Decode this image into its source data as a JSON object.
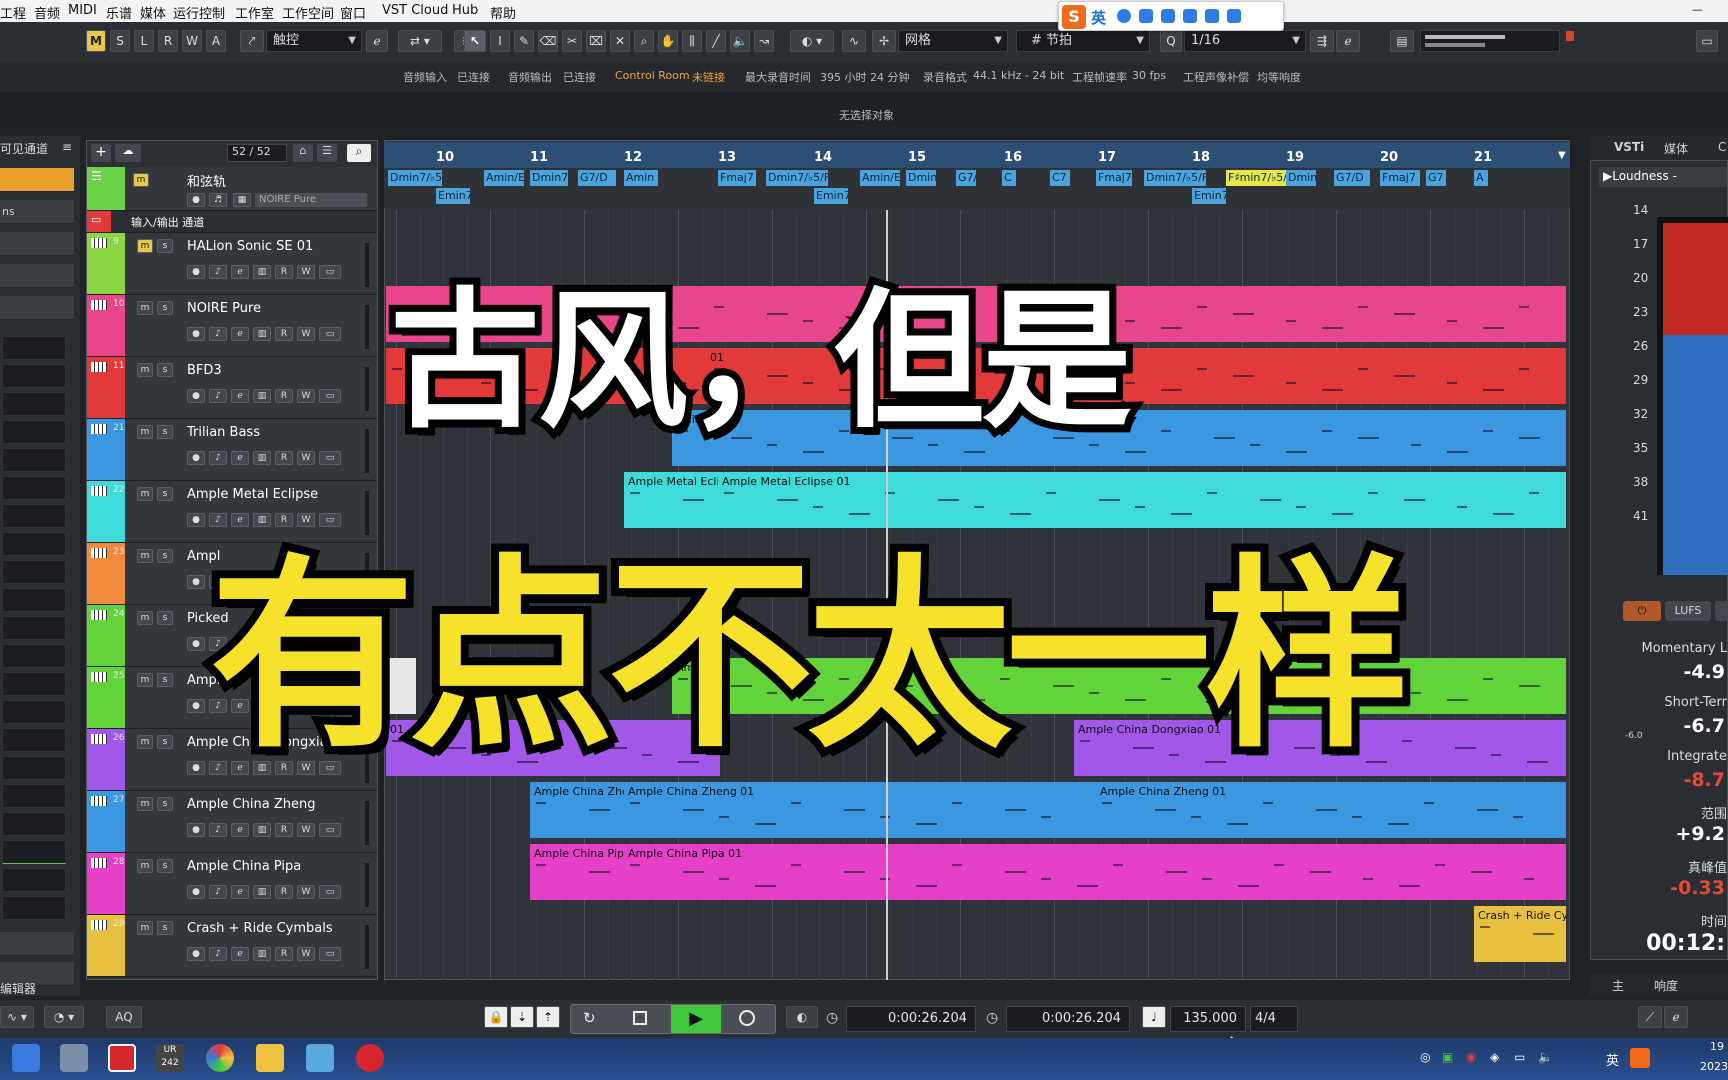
{
  "menu": [
    "工程",
    "音频",
    "MIDI",
    "乐谱",
    "媒体",
    "运行控制",
    "工作室",
    "工作空间",
    "窗口",
    "VST Cloud",
    "Hub",
    "帮助"
  ],
  "ime": {
    "lang": "英"
  },
  "toolbar": {
    "modes": [
      "M",
      "S",
      "L",
      "R",
      "W",
      "A"
    ],
    "automation_mode": "触控",
    "snap_type": "网格",
    "grid_type": "节拍",
    "quantize": "1/16"
  },
  "status": {
    "audio_in_label": "音频输入",
    "audio_in_val": "已连接",
    "audio_out_label": "音频输出",
    "audio_out_val": "已连接",
    "control_room_label": "Control Room",
    "control_room_val": "未链接",
    "max_rec_label": "最大录音时间",
    "max_rec_val": "395 小时 24 分钟",
    "rec_format_label": "录音格式",
    "rec_format_val": "44.1 kHz - 24 bit",
    "frame_rate_label": "工程帧速率",
    "frame_rate_val": "30 fps",
    "pan_law_label": "工程声像补偿",
    "pan_law_val": "均等响度"
  },
  "info_line": "无选择对象",
  "left_panel": {
    "title": "可见通道",
    "row_label": "ns",
    "footer": "编辑器"
  },
  "track_header": {
    "count": "52 / 52"
  },
  "ruler": [
    "10",
    "11",
    "12",
    "13",
    "14",
    "15",
    "16",
    "17",
    "18",
    "19",
    "20",
    "21"
  ],
  "chords": {
    "top": [
      "Dmin7/♭5/F",
      "Amin/E",
      "Dmin7",
      "G7/D",
      "Amin",
      "Fmaj7",
      "Dmin7/♭5/F",
      "Amin/E",
      "Dmin",
      "G7/D",
      "C",
      "C7",
      "Fmaj7",
      "Dmin7/♭5/F",
      "F♯min7/♭5/E",
      "Dmin",
      "G7/D",
      "Fmaj7",
      "G7",
      "A"
    ],
    "bottom": [
      "Emin7",
      "Emin7",
      "Emin7"
    ]
  },
  "chord_track": {
    "name": "和弦轨",
    "instrument": "NOIRE Pure"
  },
  "folder": {
    "name": "输入/输出 通道"
  },
  "tracks": [
    {
      "num": "9",
      "name": "HALion Sonic SE 01",
      "color": "#8bd645"
    },
    {
      "num": "10",
      "name": "NOIRE Pure",
      "color": "#e8468a"
    },
    {
      "num": "11",
      "name": "BFD3",
      "color": "#e23a3a"
    },
    {
      "num": "21",
      "name": "Trilian Bass",
      "color": "#3b97df"
    },
    {
      "num": "22",
      "name": "Ample Metal Eclipse",
      "color": "#3fdada"
    },
    {
      "num": "23",
      "name": "Ampl",
      "color": "#f08a3c"
    },
    {
      "num": "24",
      "name": "Picked",
      "color": "#62d43a"
    },
    {
      "num": "25",
      "name": "Ample C",
      "color": "#62d43a"
    },
    {
      "num": "26",
      "name": "Ample China Dongxiao",
      "color": "#a157e8"
    },
    {
      "num": "27",
      "name": "Ample China Zheng",
      "color": "#3b97df"
    },
    {
      "num": "28",
      "name": "Ample China Pipa",
      "color": "#e63fc8"
    },
    {
      "num": "29",
      "name": "Crash + Ride Cymbals",
      "color": "#e8c040"
    }
  ],
  "parts": {
    "bfd": "01",
    "trilian": "Trilian",
    "metal_a": "Ample Metal Eclip",
    "metal_b": "Ample Metal Eclipse 01",
    "green": "Am",
    "dongxiao_a": "01",
    "dongxiao_b": "Ample China Dongxiao 01",
    "zheng_a": "Ample China Zher",
    "zheng_b": "Ample China Zheng 01",
    "zheng_c": "Ample China Zheng 01",
    "pipa_a": "Ample China Pipa",
    "pipa_b": "Ample China Pipa 01",
    "crash": "Crash + Ride Cym"
  },
  "right_panel": {
    "tabs": [
      "VSTi",
      "媒体",
      "C"
    ],
    "meter_title": "Loudness",
    "meter_title_suffix": "-",
    "scale": [
      "14",
      "17",
      "20",
      "23",
      "26",
      "29",
      "32",
      "35",
      "38",
      "41"
    ],
    "lufs_btn": "LUFS",
    "peak_mark": "-6.0",
    "momentary_label": "Momentary L",
    "momentary_val": "-4.9",
    "short_label": "Short-Terr",
    "short_val": "-6.7",
    "integrated_label": "Integrate",
    "integrated_val": "-8.7",
    "range_label": "范围",
    "range_val": "+9.2",
    "truepeak_label": "真峰值",
    "truepeak_val": "-0.33",
    "time_label": "时间",
    "time_val": "00:12:",
    "bottom_tabs": [
      "主",
      "响度"
    ]
  },
  "transport": {
    "aq": "AQ",
    "time1": "0:00:26.204",
    "time2": "0:00:26.204",
    "tempo": "135.000",
    "sig": "4/4"
  },
  "taskbar": {
    "badge": "UR 242",
    "ime": "英",
    "clock": "19",
    "year": "2023"
  },
  "overlay": {
    "line1": "古风，但是",
    "line2": "有点不太一样"
  }
}
